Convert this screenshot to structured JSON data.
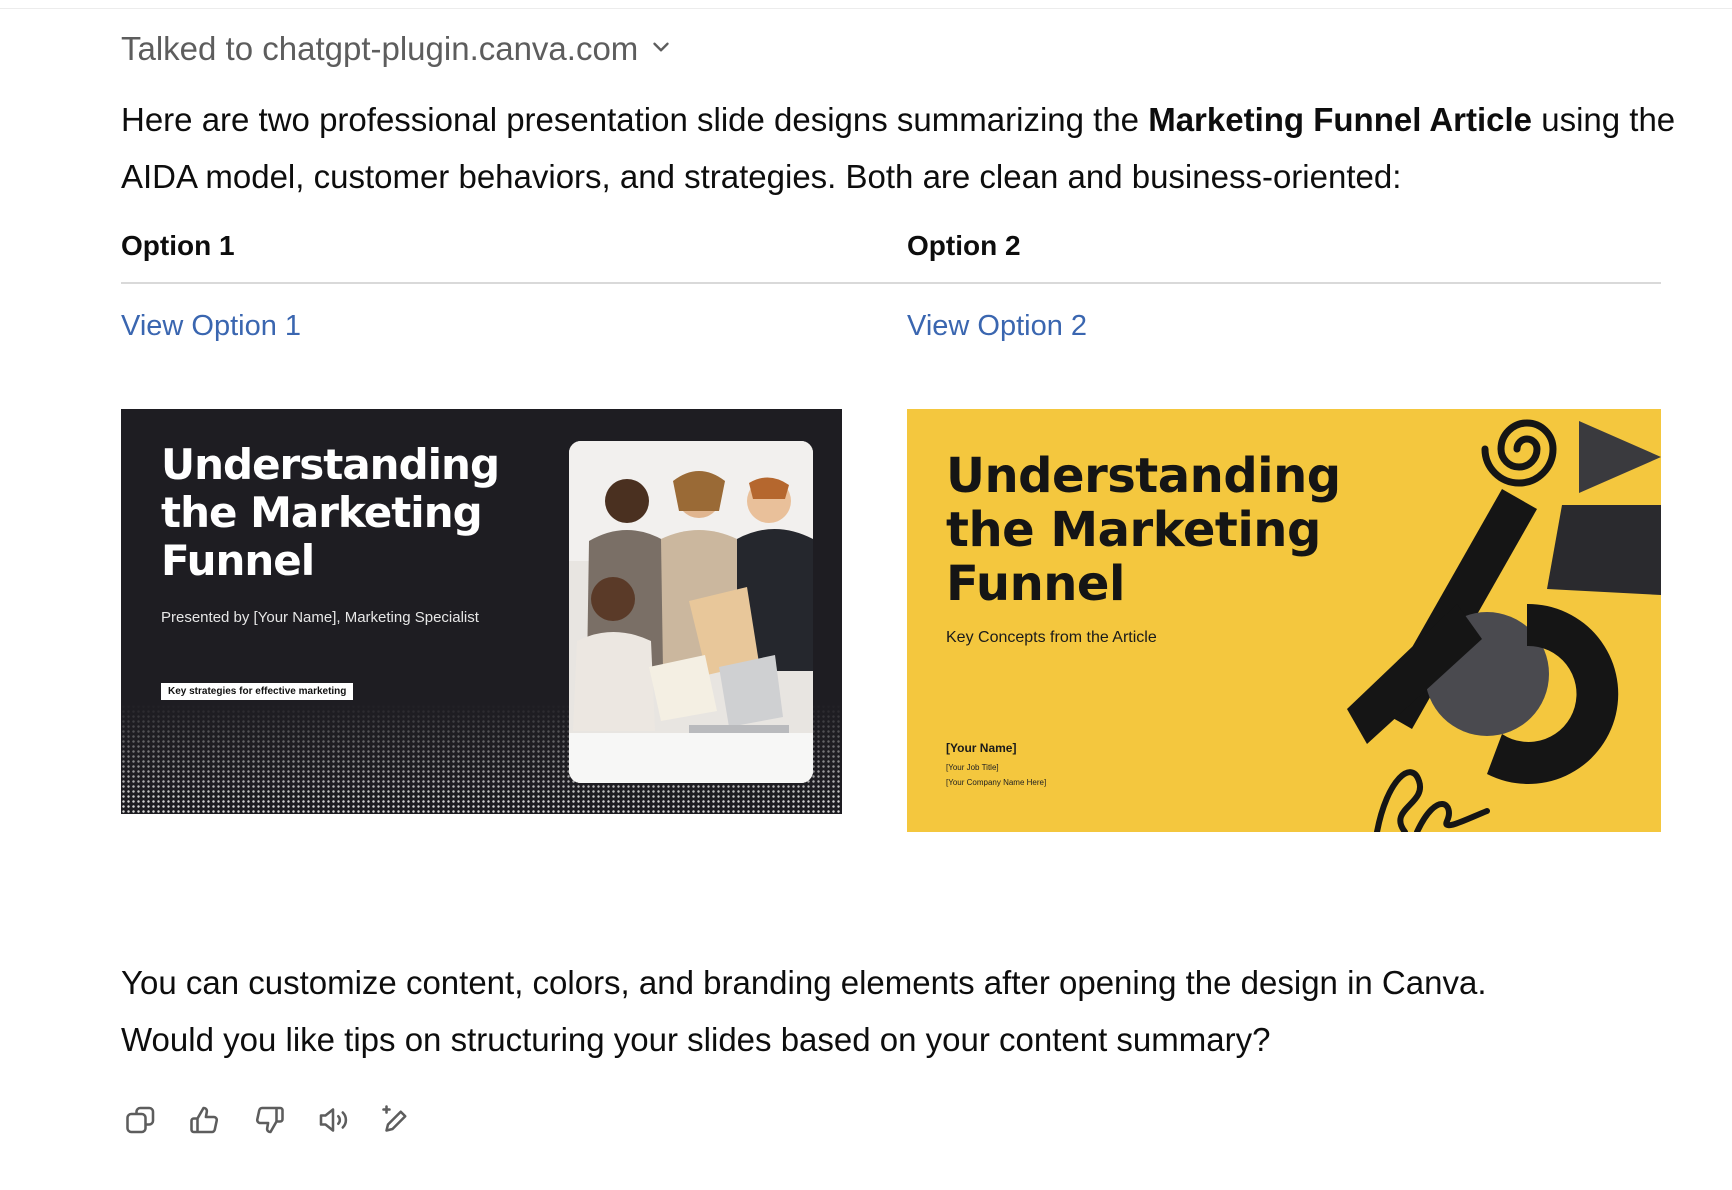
{
  "tool_status": {
    "label": "Talked to chatgpt-plugin.canva.com"
  },
  "intro": {
    "before": "Here are two professional presentation slide designs summarizing the ",
    "bold": "Marketing Funnel Article",
    "after": " using the AIDA model, customer behaviors, and strategies. Both are clean and business-oriented:"
  },
  "options": [
    {
      "header": "Option 1",
      "link": "View Option 1"
    },
    {
      "header": "Option 2",
      "link": "View Option 2"
    }
  ],
  "slide1": {
    "title_line1": "Understanding",
    "title_line2": "the Marketing",
    "title_line3": "Funnel",
    "subtitle": "Presented by [Your Name], Marketing Specialist",
    "badge": "Key strategies for effective marketing"
  },
  "slide2": {
    "title_line1": "Understanding",
    "title_line2": "the Marketing",
    "title_line3": "Funnel",
    "subtitle": "Key Concepts from the Article",
    "name": "[Your Name]",
    "job": "[Your Job Title]",
    "company": "[Your Company Name Here]"
  },
  "outro": {
    "line1": "You can customize content, colors, and branding elements after opening the design in Canva.",
    "line2": "Would you like tips on structuring your slides based on your content summary?"
  },
  "colors": {
    "link": "#3a66b0",
    "slide1_bg": "#1e1d22",
    "slide2_bg": "#f4c73e"
  },
  "actions": [
    "copy-icon",
    "thumbs-up-icon",
    "thumbs-down-icon",
    "read-aloud-icon",
    "edit-sparkle-icon"
  ]
}
